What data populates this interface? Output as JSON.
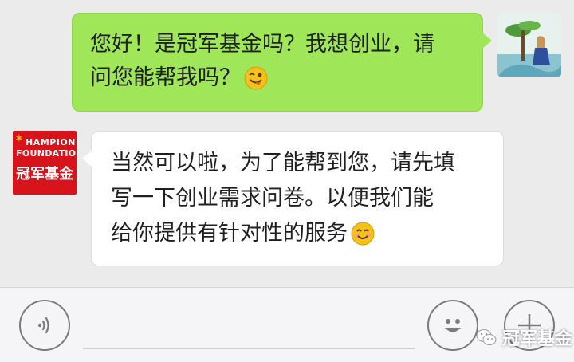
{
  "conversation": {
    "outgoing": {
      "line1": "您好！是冠军基金吗？我想创业，请",
      "line2": "问您能帮我吗？"
    },
    "incoming": {
      "line1": "当然可以啦，为了能帮到您，请先填",
      "line2": "写一下创业需求问卷。以便我们能",
      "line3": "给你提供有针对性的服务"
    },
    "brand_avatar": {
      "line1": "HAMPION",
      "line2": "FOUNDATION",
      "line3": "冠军基金"
    }
  },
  "input_bar": {
    "voice_icon": "voice-wave-icon",
    "emoji_icon": "smiley-icon",
    "plus_icon": "plus-icon"
  },
  "watermark": {
    "text": "冠军基金"
  },
  "colors": {
    "outgoing_bubble": "#9fe658",
    "incoming_bubble": "#ffffff",
    "background": "#ebebeb",
    "brand_red": "#d7141c"
  }
}
